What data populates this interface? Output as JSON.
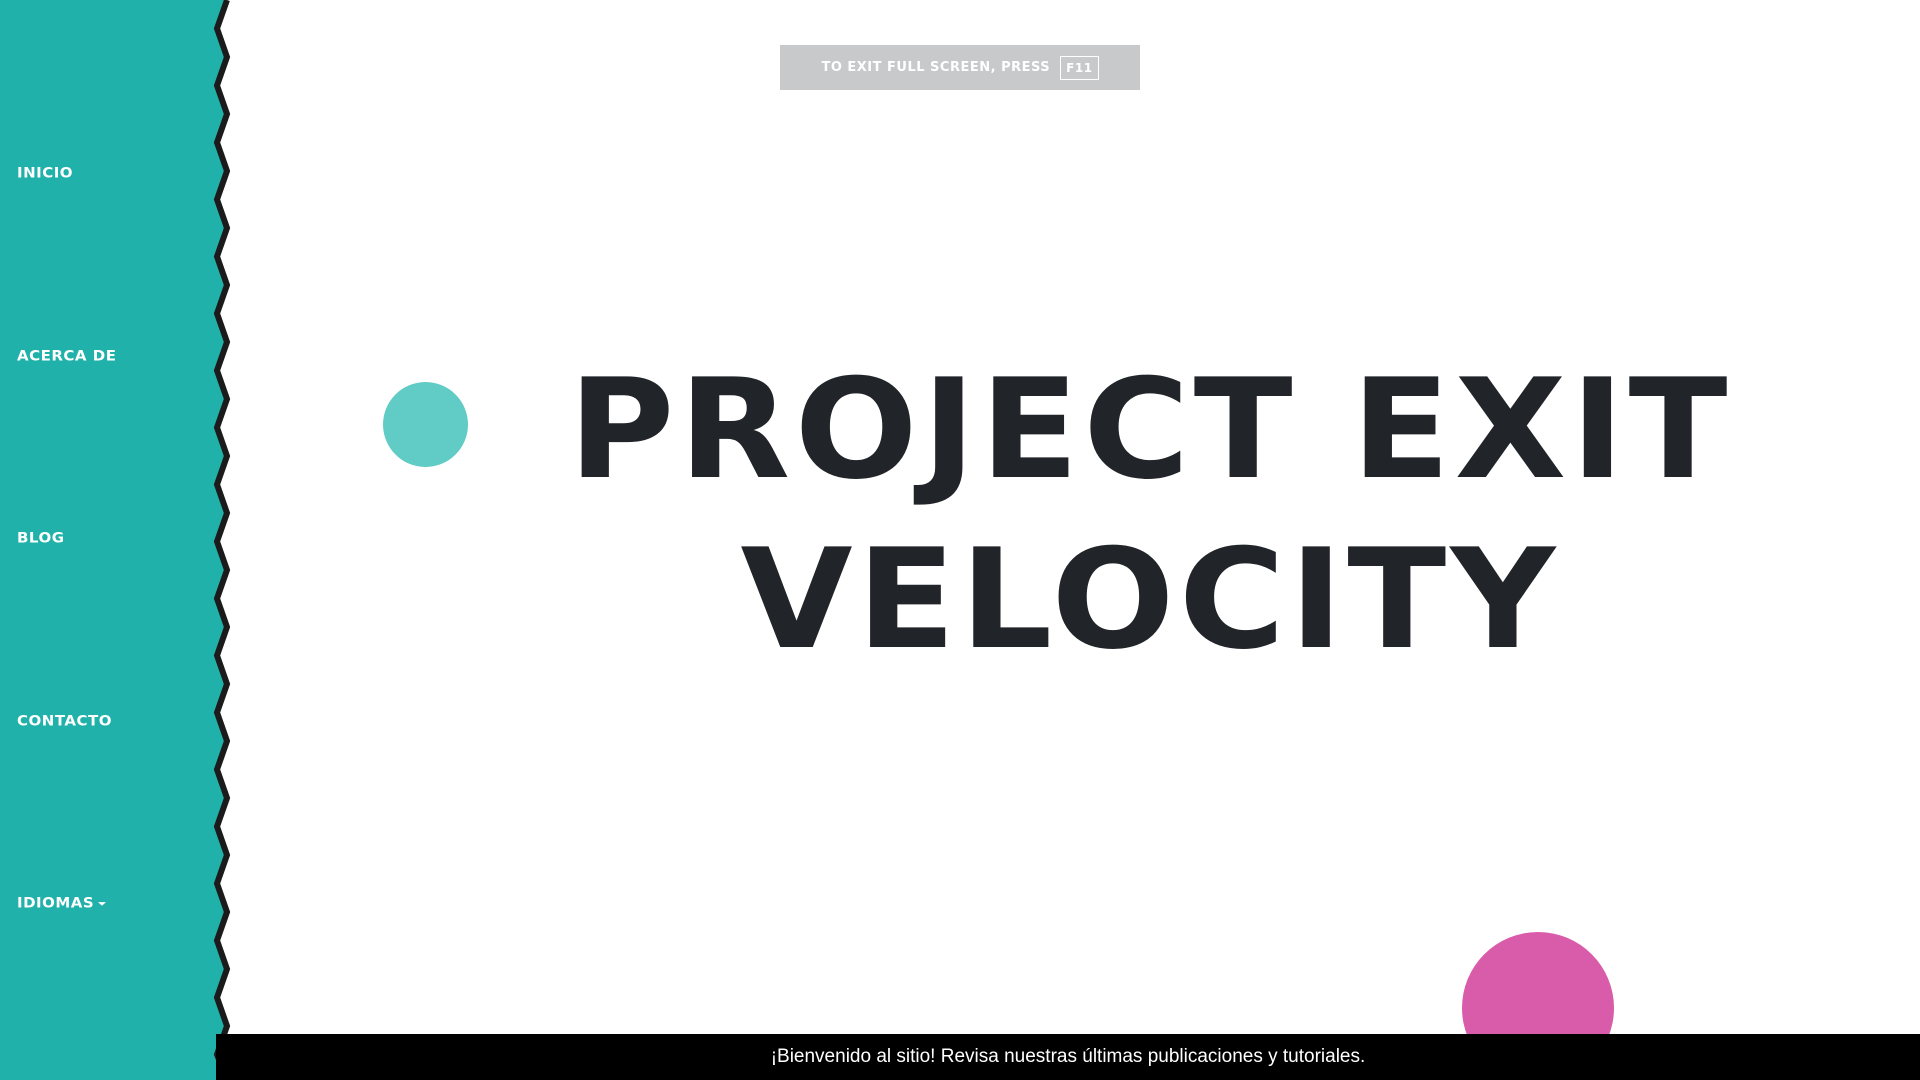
{
  "sidebar": {
    "background_color": "#20b2aa",
    "items": [
      {
        "label": "INICIO"
      },
      {
        "label": "ACERCA DE"
      },
      {
        "label": "BLOG"
      },
      {
        "label": "CONTACTO"
      },
      {
        "label": "IDIOMAS",
        "icon": "caret-down-icon"
      }
    ]
  },
  "fullscreen_notice": {
    "text": "TO EXIT FULL SCREEN, PRESS",
    "key": "F11"
  },
  "hero": {
    "title_line1": "PROJECT EXIT",
    "title_line2": "VELOCITY",
    "text_color": "#212529"
  },
  "decor": {
    "circle_teal_color": "#61cbc5",
    "circle_pink_color": "#d95caa"
  },
  "ticker": {
    "text": "¡Bienvenido al sitio! Revisa nuestras últimas publicaciones y tutoriales."
  }
}
